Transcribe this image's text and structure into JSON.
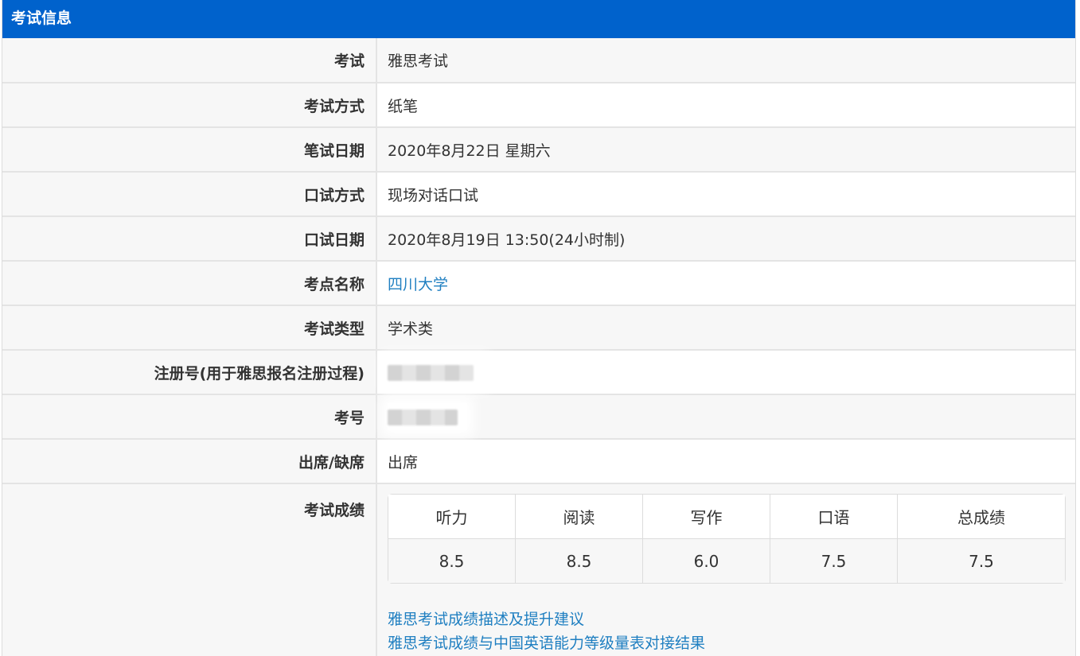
{
  "header": {
    "title": "考试信息"
  },
  "rows": [
    {
      "label": "考试",
      "value": "雅思考试"
    },
    {
      "label": "考试方式",
      "value": "纸笔"
    },
    {
      "label": "笔试日期",
      "value": "2020年8月22日 星期六"
    },
    {
      "label": "口试方式",
      "value": "现场对话口试"
    },
    {
      "label": "口试日期",
      "value": "2020年8月19日 13:50(24小时制)"
    },
    {
      "label": "考点名称",
      "value": "四川大学"
    },
    {
      "label": "考试类型",
      "value": "学术类"
    },
    {
      "label": "注册号(用于雅思报名注册过程)",
      "value": ""
    },
    {
      "label": "考号",
      "value": ""
    },
    {
      "label": "出席/缺席",
      "value": "出席"
    }
  ],
  "scores": {
    "label": "考试成绩",
    "headers": [
      "听力",
      "阅读",
      "写作",
      "口语",
      "总成绩"
    ],
    "values": [
      "8.5",
      "8.5",
      "6.0",
      "7.5",
      "7.5"
    ]
  },
  "links": [
    "雅思考试成绩描述及提升建议",
    "雅思考试成绩与中国英语能力等级量表对接结果"
  ],
  "colors": {
    "header_bg": "#0062cc",
    "link": "#1f7fc1",
    "row_alt": "#f7f7f7"
  }
}
